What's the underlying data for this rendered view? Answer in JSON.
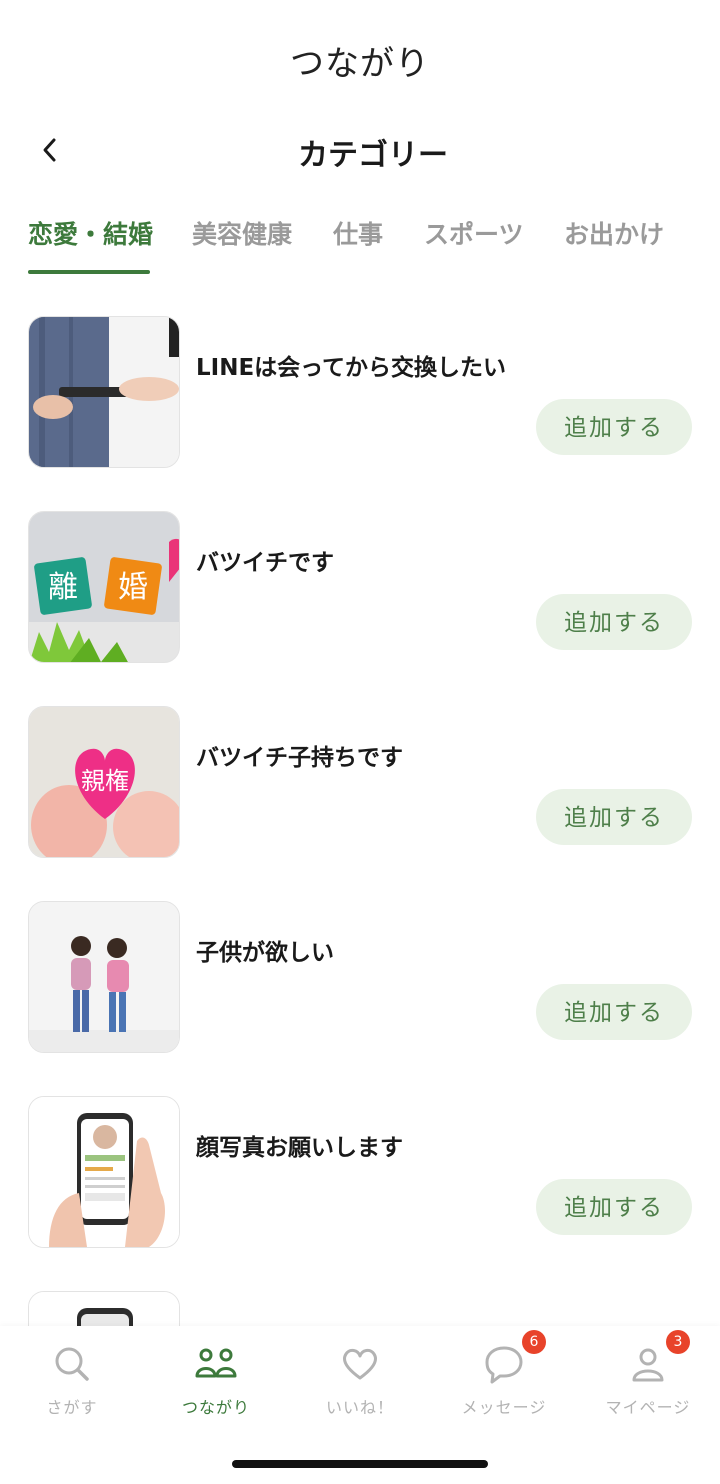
{
  "app_title": "つながり",
  "header": {
    "title": "カテゴリー"
  },
  "tabs": [
    {
      "label": "恋愛・結婚",
      "active": true
    },
    {
      "label": "美容健康",
      "active": false
    },
    {
      "label": "仕事",
      "active": false
    },
    {
      "label": "スポーツ",
      "active": false
    },
    {
      "label": "お出かけ",
      "active": false
    }
  ],
  "items": [
    {
      "title": "LINEは会ってから交換したい",
      "button": "追加する"
    },
    {
      "title": "バツイチです",
      "button": "追加する",
      "thumb_text": [
        "離",
        "婚"
      ]
    },
    {
      "title": "バツイチ子持ちです",
      "button": "追加する",
      "thumb_text": [
        "親権"
      ]
    },
    {
      "title": "子供が欲しい",
      "button": "追加する"
    },
    {
      "title": "顔写真お願いします",
      "button": "追加する"
    }
  ],
  "bottom_nav": [
    {
      "label": "さがす",
      "icon": "search-icon",
      "active": false
    },
    {
      "label": "つながり",
      "icon": "people-icon",
      "active": true
    },
    {
      "label": "いいね！",
      "icon": "heart-icon",
      "active": false
    },
    {
      "label": "メッセージ",
      "icon": "chat-icon",
      "active": false,
      "badge": "6"
    },
    {
      "label": "マイページ",
      "icon": "user-icon",
      "active": false,
      "badge": "3"
    }
  ],
  "colors": {
    "accent": "#3d7a3c",
    "button_bg": "#e9f2e6",
    "badge": "#e8432a"
  }
}
